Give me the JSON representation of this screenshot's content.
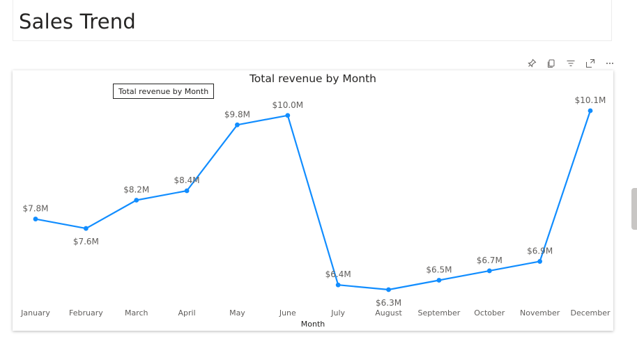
{
  "page": {
    "title": "Sales Trend"
  },
  "toolbar": {
    "icons": [
      "pin-icon",
      "copy-icon",
      "filter-icon",
      "focus-mode-icon",
      "more-options-icon"
    ]
  },
  "tooltip": {
    "text": "Total revenue by Month"
  },
  "colors": {
    "series": "#118DFF",
    "title": "#252423",
    "label": "#605e5c"
  },
  "chart_data": {
    "type": "line",
    "title": "Total revenue by Month",
    "xlabel": "Month",
    "ylabel": "",
    "categories": [
      "January",
      "February",
      "March",
      "April",
      "May",
      "June",
      "July",
      "August",
      "September",
      "October",
      "November",
      "December"
    ],
    "values": [
      7.8,
      7.6,
      8.2,
      8.4,
      9.8,
      10.0,
      6.4,
      6.3,
      6.5,
      6.7,
      6.9,
      10.1
    ],
    "data_labels": [
      "$7.8M",
      "$7.6M",
      "$8.2M",
      "$8.4M",
      "$9.8M",
      "$10.0M",
      "$6.4M",
      "$6.3M",
      "$6.5M",
      "$6.7M",
      "$6.9M",
      "$10.1M"
    ],
    "unit": "$M",
    "grid": false,
    "legend": "none"
  }
}
